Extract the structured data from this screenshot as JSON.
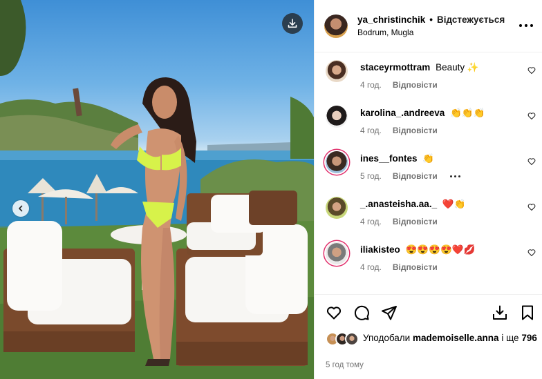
{
  "post": {
    "media_alt_icons": {
      "download": "download-icon",
      "previous": "chevron-left-icon"
    }
  },
  "header": {
    "username": "ya_christinchik",
    "separator": "•",
    "follow_status": "Відстежується",
    "location": "Bodrum, Mugla",
    "more_icon": "more-horizontal-icon"
  },
  "comments": [
    {
      "user": "staceyrmottram",
      "text": "Beauty ✨",
      "time": "4 год.",
      "reply": "Відповісти"
    },
    {
      "user": "karolina_.andreeva",
      "text": "👏👏👏",
      "time": "4 год.",
      "reply": "Відповісти"
    },
    {
      "user": "ines__fontes",
      "text": "👏",
      "time": "5 год.",
      "reply": "Відповісти"
    },
    {
      "user": "_.anasteisha.aa._",
      "text": "❤️👏",
      "time": "4 год.",
      "reply": "Відповісти"
    },
    {
      "user": "iliakisteo",
      "text": "😍😍😍😍❤️💋",
      "time": "4 год.",
      "reply": "Відповісти"
    }
  ],
  "actions": {
    "icons": [
      "heart-icon",
      "comment-icon",
      "share-icon",
      "save-to-device-icon",
      "bookmark-icon"
    ]
  },
  "likes": {
    "prefix": "Уподобали",
    "user": "mademoiselle.anna",
    "middle": "і ще",
    "count": "796"
  },
  "timestamp": "5 год тому",
  "colors": {
    "story_ring": "#e1306c",
    "muted": "#737373",
    "border": "#efefef"
  }
}
